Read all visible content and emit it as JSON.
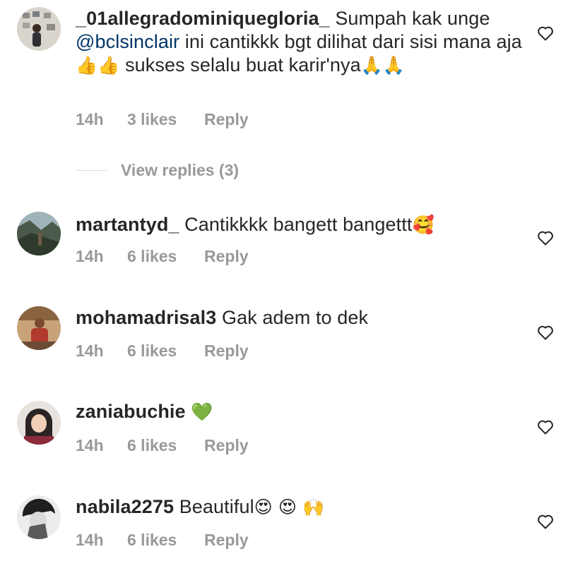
{
  "comments": [
    {
      "username": "_01allegradominiquegloria_",
      "text_1": " Sumpah kak unge ",
      "mention": "@bclsinclair",
      "text_2": " ini cantikkk bgt dilihat dari sisi mana aja",
      "emoji_1": "👍👍",
      "text_3": " sukses selalu buat karir'nya",
      "emoji_2": "🙏🙏",
      "time": "14h",
      "likes": "3 likes",
      "reply": "Reply",
      "avatar_icon": "avatar-photo"
    },
    {
      "username": "martantyd_",
      "text": " Cantikkkk bangett bangettt",
      "emoji": "🥰",
      "time": "14h",
      "likes": "6 likes",
      "reply": "Reply",
      "avatar_icon": "avatar-photo"
    },
    {
      "username": "mohamadrisal3",
      "text": " Gak adem to dek",
      "emoji": "",
      "time": "14h",
      "likes": "6 likes",
      "reply": "Reply",
      "avatar_icon": "avatar-photo"
    },
    {
      "username": "zaniabuchie",
      "text": " ",
      "emoji": "💚",
      "time": "14h",
      "likes": "6 likes",
      "reply": "Reply",
      "avatar_icon": "avatar-photo"
    },
    {
      "username": "nabila2275",
      "text": " Beautiful",
      "emoji": "😍 😍 🙌",
      "time": "14h",
      "likes": "6 likes",
      "reply": "Reply",
      "avatar_icon": "avatar-photo"
    }
  ],
  "view_replies": "View replies (3)",
  "icons": {
    "like": "heart-outline-icon"
  },
  "colors": {
    "meta": "#999999",
    "mention": "#003569",
    "text": "#262626"
  }
}
